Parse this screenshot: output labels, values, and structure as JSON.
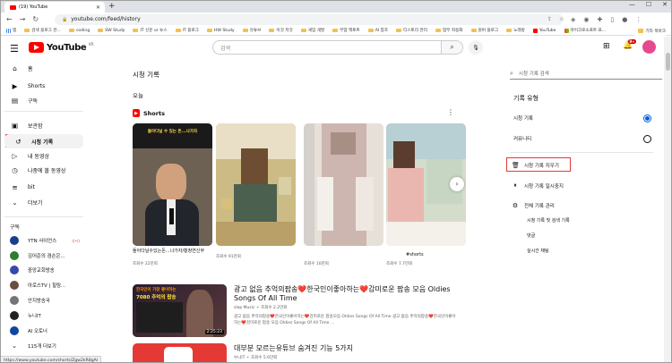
{
  "browser": {
    "tab_title": "(19) YouTube",
    "url": "youtube.com/feed/history",
    "status_url": "https://www.youtube.com/shorts/Zgw2kR8gAl"
  },
  "bookmarks": [
    {
      "label": "앱",
      "type": "apps"
    },
    {
      "label": "검색 블로그 관...",
      "type": "folder"
    },
    {
      "label": "coding",
      "type": "folder"
    },
    {
      "label": "SW Study",
      "type": "folder"
    },
    {
      "label": "IT 신문 or 뉴스",
      "type": "folder"
    },
    {
      "label": "IT 블로그",
      "type": "folder"
    },
    {
      "label": "HW Study",
      "type": "folder"
    },
    {
      "label": "유튜브",
      "type": "folder"
    },
    {
      "label": "이것 저것",
      "type": "folder"
    },
    {
      "label": "게임 개발",
      "type": "folder"
    },
    {
      "label": "부업 액토트",
      "type": "folder"
    },
    {
      "label": "AI 참조",
      "type": "folder"
    },
    {
      "label": "티스토리 관리",
      "type": "folder"
    },
    {
      "label": "업무 자동화",
      "type": "folder"
    },
    {
      "label": "원버 블로그",
      "type": "folder"
    },
    {
      "label": "노래방",
      "type": "folder"
    },
    {
      "label": "YouTube",
      "type": "youtube"
    },
    {
      "label": "마이크로소프트 프...",
      "type": "ms"
    }
  ],
  "bookmarks_other": "기타 북마크",
  "masthead": {
    "logo_text": "YouTube",
    "logo_region": "KR",
    "search_placeholder": "검색",
    "notification_count": "9+"
  },
  "sidebar": {
    "items": [
      {
        "label": "홈",
        "icon": "home-icon"
      },
      {
        "label": "Shorts",
        "icon": "shorts-icon"
      },
      {
        "label": "구독",
        "icon": "subscriptions-icon"
      },
      {
        "label": "보관함",
        "icon": "library-icon"
      },
      {
        "label": "시청 기록",
        "icon": "history-icon",
        "selected": true
      },
      {
        "label": "내 동영상",
        "icon": "my-videos-icon"
      },
      {
        "label": "나중에 볼 동영상",
        "icon": "watch-later-icon"
      },
      {
        "label": "bit",
        "icon": "playlist-icon"
      },
      {
        "label": "더보기",
        "icon": "chevron-down-icon"
      }
    ],
    "subscriptions_header": "구독",
    "subscriptions": [
      {
        "label": "YTN 사이언스",
        "color": "#1a3e8c",
        "live": true
      },
      {
        "label": "김어준의 겸손은...",
        "color": "#2e7d32",
        "live": false
      },
      {
        "label": "중앙교회방송",
        "color": "#3949ab",
        "live": false
      },
      {
        "label": "아로스TV | 힐링...",
        "color": "#6d4c41",
        "live": false
      },
      {
        "label": "안지방송국",
        "color": "#757575",
        "live": false
      },
      {
        "label": "누니IT",
        "color": "#212121",
        "live": false
      },
      {
        "label": "AI 오토너",
        "color": "#0d47a1",
        "live": false
      },
      {
        "label": "115개 더보기",
        "color": "",
        "live": false
      }
    ]
  },
  "main": {
    "title": "시청 기록",
    "section_today": "오늘",
    "shorts_label": "Shorts",
    "shorts": [
      {
        "title": "돌아다닐수있는돈...나가자/황창연신부",
        "views": "조회수 22만회",
        "thumb_caption": "돌아다닐 수 있는 돈...나가자"
      },
      {
        "title": "",
        "views": "조회수 91만회",
        "thumb_caption": ""
      },
      {
        "title": "",
        "views": "조회수 10만회",
        "thumb_caption": ""
      },
      {
        "title": "#shorts",
        "views": "조회수 7.7만회",
        "thumb_caption": ""
      }
    ],
    "videos": [
      {
        "title": "광고 없음 추억의팝송❤️한국인이좋아하는❤️감미로운 팝송 모음 Oldies Songs Of All Time",
        "channel": "slep Music",
        "views": "조회수 2.2만회",
        "description": "광고 없음 추억의팝송❤️한국인이좋아하는❤️감미로운 팝송모음 Oldies Songs Of All Time 광고 없음 추억의팝송❤️한국인이좋아하는❤️감미로운 팝송 모음 Oldies Songs Of All Time ...",
        "thumb_line1": "한국인이 가장 좋아하는",
        "thumb_line2": "7080 추억의 팝송",
        "duration": "2:25:23"
      },
      {
        "title": "대부분 모르는유튜브 숨겨진 기능 5가지",
        "channel": "누니IT",
        "views": "조회수 5.6만회"
      }
    ]
  },
  "history_panel": {
    "search_placeholder": "시청 기록 검색",
    "type_header": "기록 유형",
    "types": [
      {
        "label": "시청 기록",
        "selected": true
      },
      {
        "label": "커뮤니티",
        "selected": false
      }
    ],
    "actions": [
      {
        "label": "시청 기록 지우기",
        "icon": "trash-icon"
      },
      {
        "label": "시청 기록 일시중지",
        "icon": "pause-icon"
      },
      {
        "label": "전체 기록 관리",
        "icon": "gear-icon"
      }
    ],
    "sub_links": [
      "시청 기록 및 검색 기록",
      "댓글",
      "실시간 채팅"
    ]
  }
}
